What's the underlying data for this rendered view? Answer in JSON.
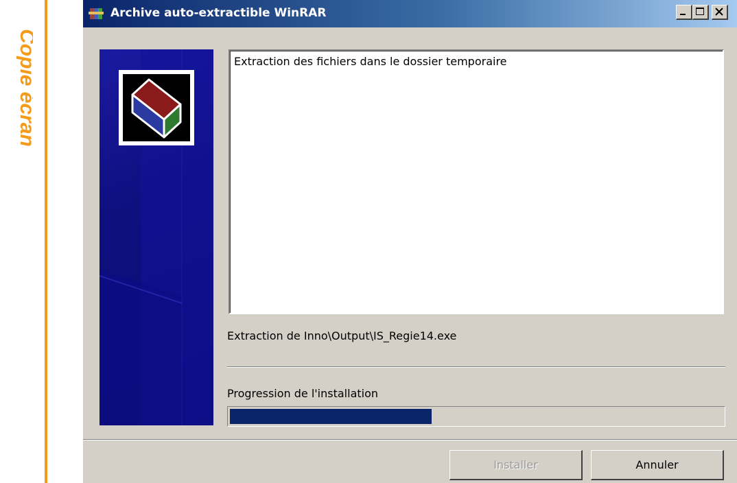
{
  "side_caption": "Copie écran",
  "window": {
    "title": "Archive auto-extractible WinRAR",
    "title_icon": "winrar-archive-icon",
    "controls": {
      "minimize_icon": "minimize-icon",
      "maximize_icon": "maximize-icon",
      "close_icon": "close-icon"
    }
  },
  "banner": {
    "logo_icon": "winrar-book-logo-icon"
  },
  "log": {
    "lines": [
      "Extraction des fichiers dans le dossier temporaire"
    ]
  },
  "status": {
    "current_file": "Extraction de Inno\\Output\\IS_Regie14.exe"
  },
  "progress": {
    "label": "Progression de l'installation",
    "percent": 41
  },
  "buttons": {
    "install_label": "Installer",
    "install_enabled": false,
    "cancel_label": "Annuler"
  },
  "colors": {
    "accent_orange": "#f39b1a",
    "title_bar_start": "#0a246a",
    "progress_fill": "#0a246a",
    "dialog_background": "#d4d0c8"
  }
}
